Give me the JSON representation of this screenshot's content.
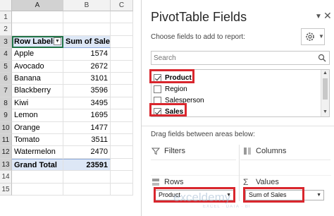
{
  "sheet": {
    "columns": [
      "A",
      "B",
      "C"
    ],
    "rows": [
      "1",
      "2",
      "3",
      "4",
      "5",
      "6",
      "7",
      "8",
      "9",
      "10",
      "11",
      "12",
      "13",
      "14",
      "15"
    ],
    "header": {
      "label": "Row Labels",
      "value": "Sum of Sales"
    },
    "data": [
      {
        "label": "Apple",
        "value": "1574"
      },
      {
        "label": "Avocado",
        "value": "2672"
      },
      {
        "label": "Banana",
        "value": "3101"
      },
      {
        "label": "Blackberry",
        "value": "3596"
      },
      {
        "label": "Kiwi",
        "value": "3495"
      },
      {
        "label": "Lemon",
        "value": "1695"
      },
      {
        "label": "Orange",
        "value": "1477"
      },
      {
        "label": "Tomato",
        "value": "3511"
      },
      {
        "label": "Watermelon",
        "value": "2470"
      }
    ],
    "total": {
      "label": "Grand Total",
      "value": "23591"
    }
  },
  "pane": {
    "title": "PivotTable Fields",
    "subtitle": "Choose fields to add to report:",
    "search_placeholder": "Search",
    "fields": [
      {
        "label": "Product",
        "checked": true
      },
      {
        "label": "Region",
        "checked": false
      },
      {
        "label": "Salesperson",
        "checked": false
      },
      {
        "label": "Sales",
        "checked": true
      }
    ],
    "drag_label": "Drag fields between areas below:",
    "areas": {
      "filters": "Filters",
      "columns": "Columns",
      "rows": "Rows",
      "values": "Values"
    },
    "rows_field": "Product",
    "values_field": "Sum of Sales",
    "highlight_color": "#d9262d"
  },
  "watermark": {
    "main": "exceldemy",
    "sub": "EXCEL · DATA · BI"
  },
  "colors": {
    "accent": "#217346",
    "pivot_header": "#dde7f6"
  }
}
